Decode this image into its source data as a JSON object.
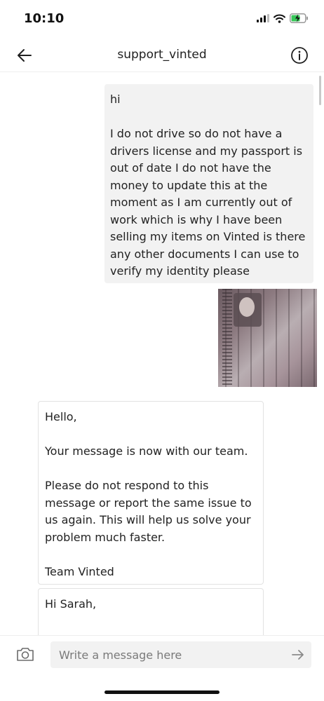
{
  "status_bar": {
    "time": "10:10"
  },
  "header": {
    "title": "support_vinted"
  },
  "messages": {
    "outgoing": {
      "greeting": "hi",
      "body": "I do not drive so do not have a drivers license and my passport is out of date I do not have the money to update this at the moment as I am currently out of work which is why I have been selling my items on Vinted is there any other documents I can use to verify my identity please"
    },
    "incoming_1": {
      "greeting": "Hello,",
      "line1": "Your message is now with our team.",
      "line2": "Please do not respond to this message or report the same issue to us again. This will help us solve your problem much faster.",
      "signature": "Team Vinted"
    },
    "incoming_2": {
      "greeting": "Hi Sarah,"
    }
  },
  "composer": {
    "placeholder": "Write a message here"
  }
}
